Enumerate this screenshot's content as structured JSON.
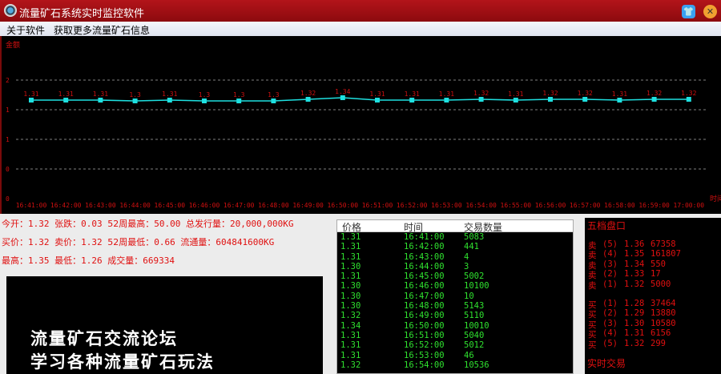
{
  "window": {
    "title": "流量矿石系统实时监控软件"
  },
  "menu": [
    "关于软件",
    "获取更多流量矿石信息"
  ],
  "chart_data": {
    "type": "line",
    "ylabel": "金额",
    "xlabel": "时间",
    "y_tick_labels": [
      "2",
      "1",
      "1",
      "0",
      "0"
    ],
    "categories": [
      "16:41:00",
      "16:42:00",
      "16:43:00",
      "16:44:00",
      "16:45:00",
      "16:46:00",
      "16:47:00",
      "16:48:00",
      "16:49:00",
      "16:50:00",
      "16:51:00",
      "16:52:00",
      "16:53:00",
      "16:54:00",
      "16:55:00",
      "16:56:00",
      "16:57:00",
      "16:58:00",
      "16:59:00",
      "17:00:00"
    ],
    "values": [
      1.31,
      1.31,
      1.31,
      1.3,
      1.31,
      1.3,
      1.3,
      1.3,
      1.32,
      1.34,
      1.31,
      1.31,
      1.31,
      1.32,
      1.31,
      1.32,
      1.32,
      1.31,
      1.32,
      1.32
    ],
    "line_color": "#1ee0e0",
    "label_color": "#d01010",
    "grid": true
  },
  "stats": [
    [
      [
        "今开：",
        "1.32 "
      ],
      [
        "张跌：",
        "0.03 "
      ],
      [
        "52周最高：",
        "50.00 "
      ],
      [
        "总发行量：",
        "20,000,000KG"
      ]
    ],
    [
      [
        "买价：",
        "1.32 "
      ],
      [
        "卖价：",
        "1.32 "
      ],
      [
        "52周最低：",
        "0.66 "
      ],
      [
        "流通量：",
        "604841600KG"
      ]
    ],
    [
      [
        "最高：",
        "1.35 "
      ],
      [
        "最低：",
        "1.26 "
      ],
      [
        "成交量：",
        "669334"
      ]
    ]
  ],
  "ad": [
    "流量矿石交流论坛",
    "学习各种流量矿石玩法"
  ],
  "trades": {
    "headers": [
      "价格",
      "时间",
      "交易数量"
    ],
    "rows": [
      [
        "1.31",
        "16:41:00",
        "5083"
      ],
      [
        "1.31",
        "16:42:00",
        "441"
      ],
      [
        "1.31",
        "16:43:00",
        "4"
      ],
      [
        "1.30",
        "16:44:00",
        "3"
      ],
      [
        "1.31",
        "16:45:00",
        "5002"
      ],
      [
        "1.30",
        "16:46:00",
        "10100"
      ],
      [
        "1.30",
        "16:47:00",
        "10"
      ],
      [
        "1.30",
        "16:48:00",
        "5143"
      ],
      [
        "1.32",
        "16:49:00",
        "5110"
      ],
      [
        "1.34",
        "16:50:00",
        "10010"
      ],
      [
        "1.31",
        "16:51:00",
        "5040"
      ],
      [
        "1.31",
        "16:52:00",
        "5012"
      ],
      [
        "1.31",
        "16:53:00",
        "46"
      ],
      [
        "1.32",
        "16:54:00",
        "10536"
      ]
    ]
  },
  "book": {
    "title": "五档盘口",
    "sell": [
      [
        "卖",
        "(5)",
        "1.36",
        "67358"
      ],
      [
        "卖",
        "(4)",
        "1.35",
        "161807"
      ],
      [
        "卖",
        "(3)",
        "1.34",
        "550"
      ],
      [
        "卖",
        "(2)",
        "1.33",
        "17"
      ],
      [
        "卖",
        "(1)",
        "1.32",
        "5000"
      ]
    ],
    "buy": [
      [
        "买",
        "(1)",
        "1.28",
        "37464"
      ],
      [
        "买",
        "(2)",
        "1.29",
        "13880"
      ],
      [
        "买",
        "(3)",
        "1.30",
        "10580"
      ],
      [
        "买",
        "(4)",
        "1.31",
        "6156"
      ],
      [
        "买",
        "(5)",
        "1.32",
        "299"
      ]
    ],
    "realtime": "实时交易"
  }
}
